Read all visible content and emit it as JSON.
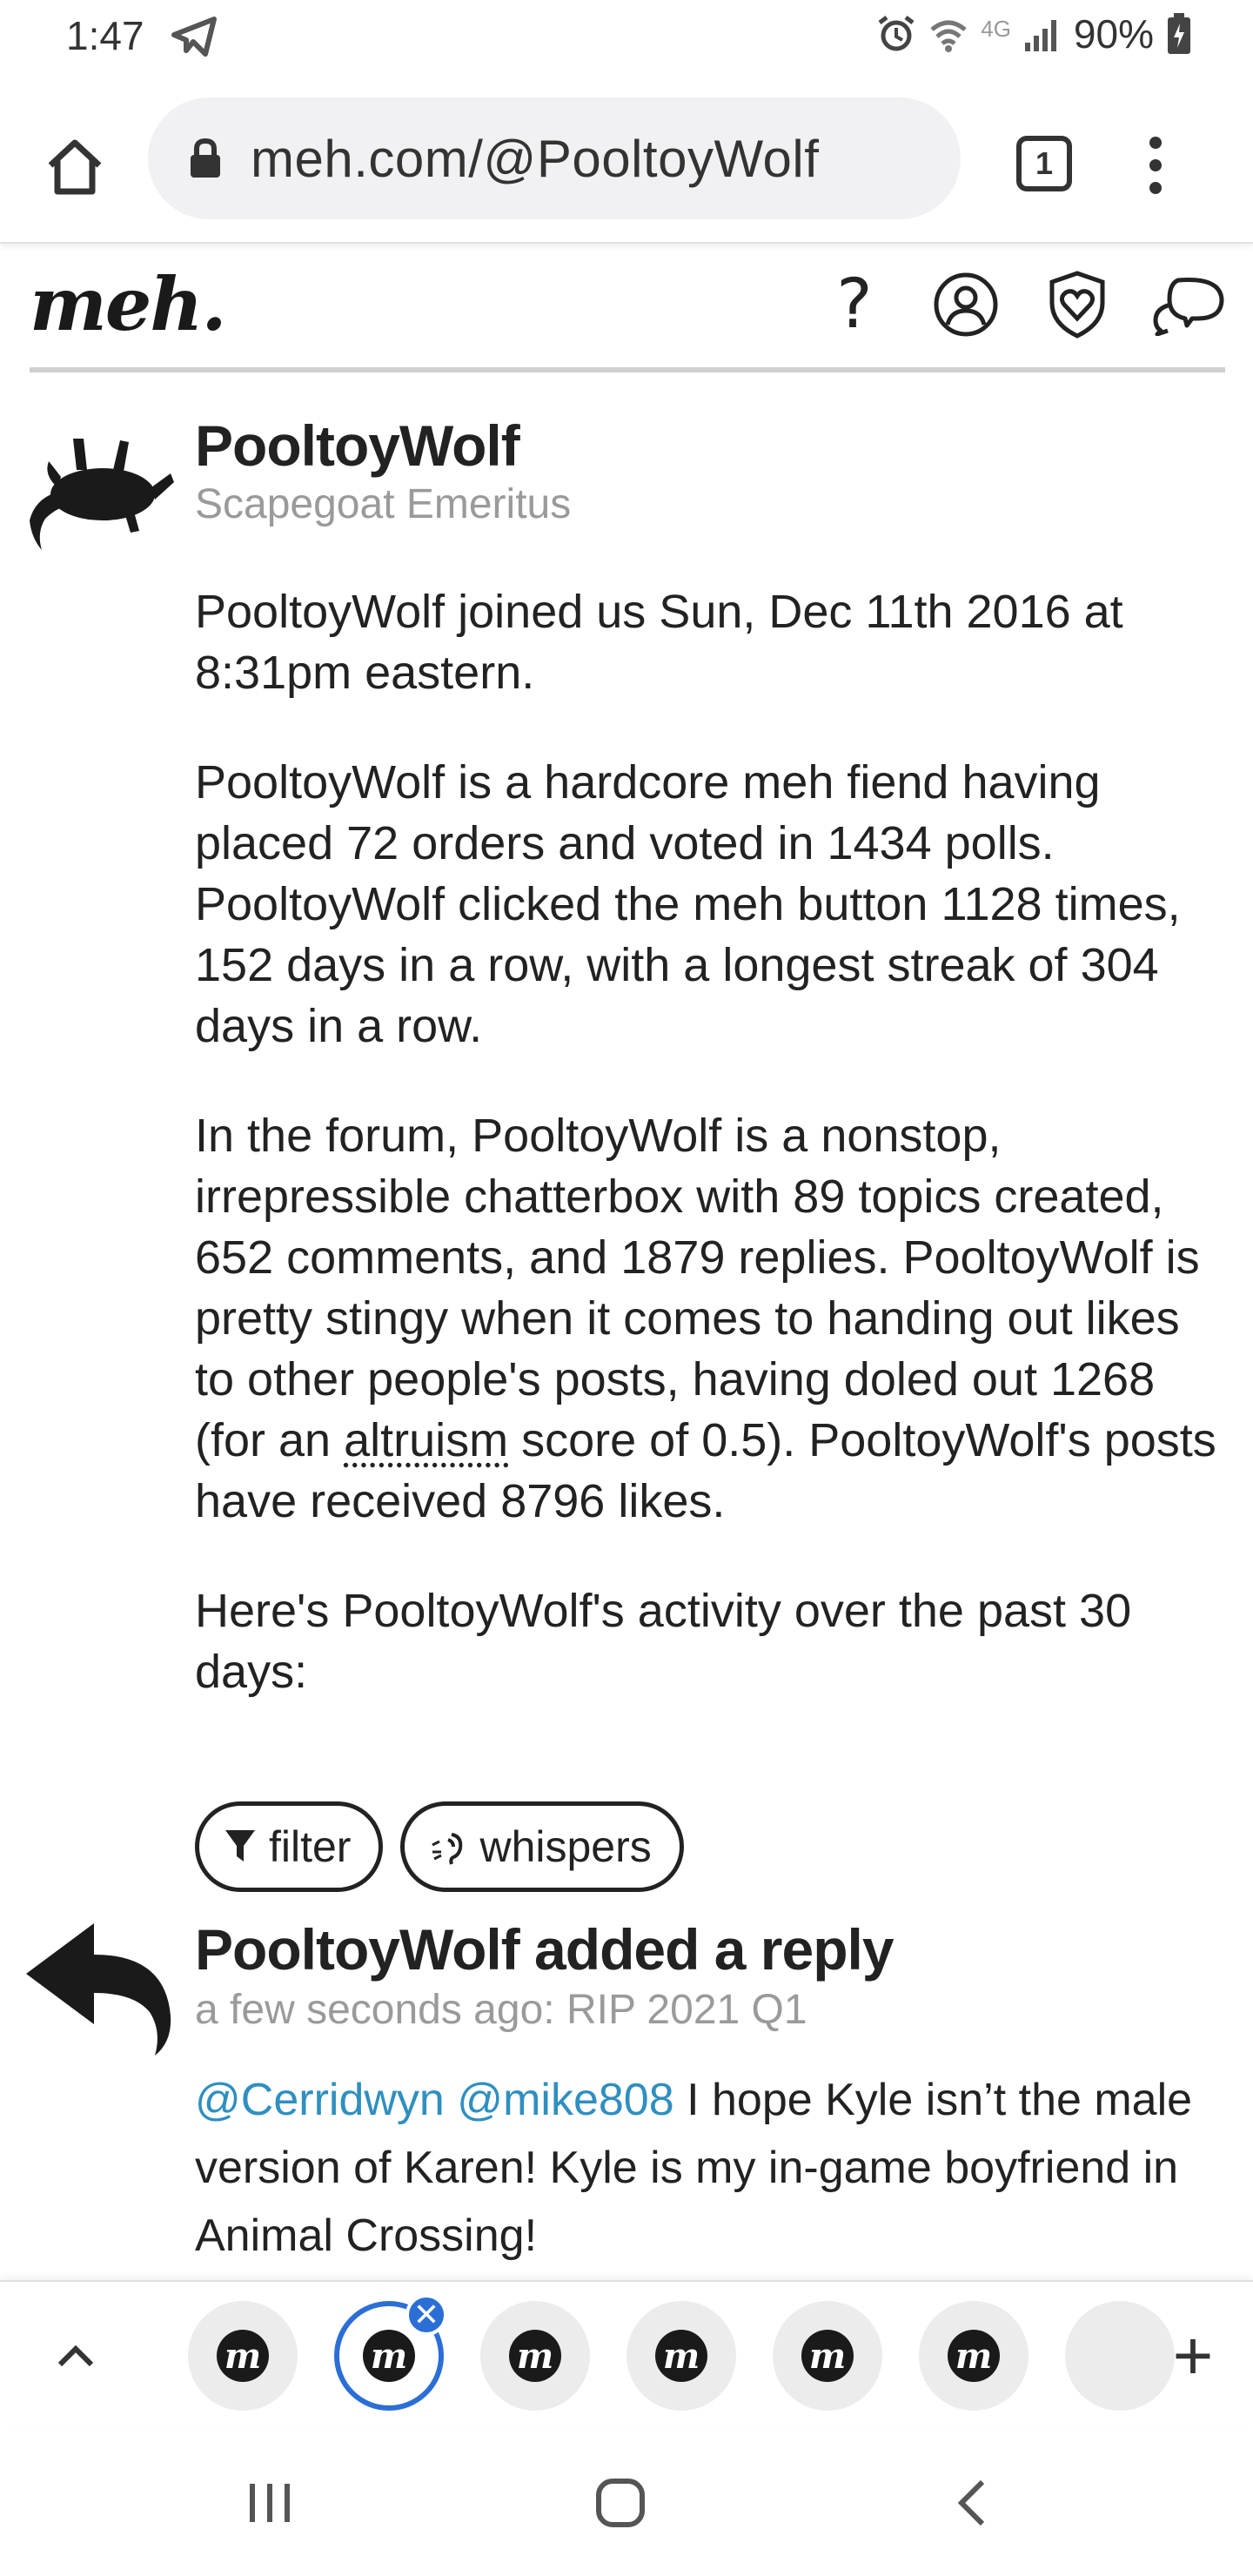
{
  "status_bar": {
    "time": "1:47",
    "network": "4G",
    "battery": "90%"
  },
  "browser": {
    "url": "meh.com/@PooltoyWolf",
    "tab_count": "1"
  },
  "site": {
    "logo": "meh.",
    "help_label": "?"
  },
  "profile": {
    "name": "PooltoyWolf",
    "subtitle": "Scapegoat Emeritus",
    "joined": "PooltoyWolf joined us Sun, Dec 11th 2016 at 8:31pm eastern.",
    "orders_stats": "PooltoyWolf is a hardcore meh fiend having placed 72 orders and voted in 1434 polls. PooltoyWolf clicked the meh button 1128 times, 152 days in a row, with a longest streak of 304 days in a row.",
    "forum_stats_1": "In the forum, PooltoyWolf is a nonstop, irrepressible chatterbox with 89 topics created, 652 comments, and 1879 replies. PooltoyWolf is pretty stingy when it comes to handing out likes to other people's posts, having doled out 1268 (for an ",
    "altruism_word": "altruism",
    "forum_stats_2": " score of 0.5). PooltoyWolf's posts have received 8796 likes.",
    "activity_intro": "Here's PooltoyWolf's activity over the past 30 days:"
  },
  "filters": {
    "filter_label": "filter",
    "whispers_label": "whispers"
  },
  "activity": {
    "title": "PooltoyWolf added a reply",
    "meta": "a few seconds ago: RIP 2021 Q1",
    "mention_1": "@Cerridwyn",
    "mention_2": "@mike808",
    "body": " I hope Kyle isn’t the male version of Karen! Kyle is my in-game boyfriend in Animal Crossing!"
  },
  "tab_strip": {
    "tab_glyph": "m",
    "close_glyph": "✕",
    "add_glyph": "+"
  }
}
